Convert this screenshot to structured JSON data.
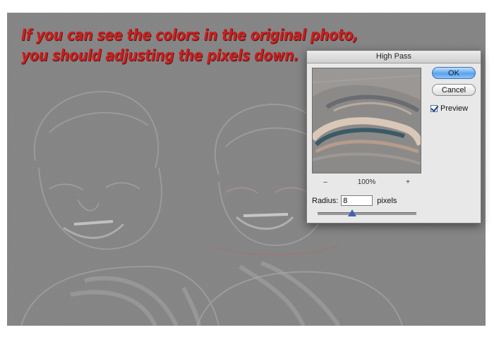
{
  "caption": {
    "line1": "If you can see the colors in the original photo,",
    "line2": "you should adjusting the pixels down.",
    "color": "#c8201f"
  },
  "dialog": {
    "title": "High Pass",
    "ok_label": "OK",
    "cancel_label": "Cancel",
    "preview_label": "Preview",
    "preview_checked": true,
    "zoom_out": "–",
    "zoom_level": "100%",
    "zoom_in": "+",
    "radius_label": "Radius:",
    "radius_value": "8",
    "radius_unit": "pixels",
    "radius_slider_fraction": 0.35
  },
  "colors": {
    "canvas_gray": "#808080",
    "ok_blue": "#5aa2ec",
    "slider_thumb": "#3f63b4"
  }
}
